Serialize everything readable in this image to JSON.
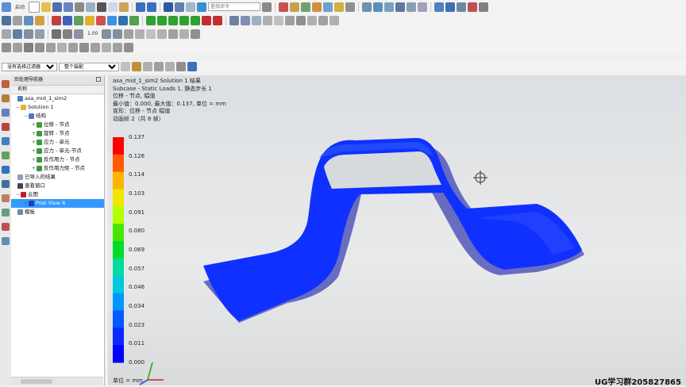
{
  "toolbar": {
    "start_label": "启动",
    "command_search_placeholder": "查找命令",
    "scale_value": "1.00",
    "filter_value": "没有选择过滤器",
    "assembly_value": "整个装配"
  },
  "navigator": {
    "title": "后处理导航器",
    "column_name": "名称",
    "items": [
      {
        "label": "asa_mid_1_sim2",
        "indent": 2,
        "exp": "",
        "icon_color": "#4a7fc0",
        "selected": false
      },
      {
        "label": "Solution 1",
        "indent": 6,
        "exp": "−",
        "icon_color": "#e2b43a",
        "selected": false
      },
      {
        "label": "结构",
        "indent": 16,
        "exp": "−",
        "icon_color": "#5a6fd0",
        "selected": false
      },
      {
        "label": "位移 - 节点",
        "indent": 26,
        "exp": "+",
        "icon_color": "#3c9a3c",
        "selected": false
      },
      {
        "label": "旋转 - 节点",
        "indent": 26,
        "exp": "+",
        "icon_color": "#3c9a3c",
        "selected": false
      },
      {
        "label": "应力 - 单元",
        "indent": 26,
        "exp": "+",
        "icon_color": "#3c9a3c",
        "selected": false
      },
      {
        "label": "应力 - 单元-节点",
        "indent": 26,
        "exp": "+",
        "icon_color": "#3c9a3c",
        "selected": false
      },
      {
        "label": "反作用力 - 节点",
        "indent": 26,
        "exp": "+",
        "icon_color": "#3c9a3c",
        "selected": false
      },
      {
        "label": "反作用力矩 - 节点",
        "indent": 26,
        "exp": "+",
        "icon_color": "#3c9a3c",
        "selected": false
      },
      {
        "label": "已导入的结果",
        "indent": 2,
        "exp": "",
        "icon_color": "#8aa0b8",
        "selected": false
      },
      {
        "label": "查看窗口",
        "indent": 2,
        "exp": "",
        "icon_color": "#444444",
        "selected": false
      },
      {
        "label": "云图",
        "indent": 6,
        "exp": "−",
        "icon_color": "#c02020",
        "selected": false
      },
      {
        "label": "Post View 6",
        "indent": 16,
        "exp": "+",
        "icon_color": "#2040c0",
        "selected": true
      },
      {
        "label": "模板",
        "indent": 2,
        "exp": "",
        "icon_color": "#6a8ab0",
        "selected": false
      }
    ]
  },
  "viewport": {
    "info_lines": [
      "asa_mid_1_sim2  Solution 1 结果",
      "Subcase - Static Loads 1, 静态步长 1",
      "位移 - 节点, 幅值",
      "最小值：0.000, 最大值：0.137, 单位 = mm",
      "变形：位移 - 节点 幅值",
      "动画帧 2（共 8 帧）"
    ],
    "legend_values": [
      "0.137",
      "0.126",
      "0.114",
      "0.103",
      "0.091",
      "0.080",
      "0.069",
      "0.057",
      "0.046",
      "0.034",
      "0.023",
      "0.011",
      "0.000"
    ],
    "legend_colors": [
      "#ff0000",
      "#ff5a00",
      "#ffb400",
      "#f0e600",
      "#b4ff00",
      "#46e600",
      "#00dc28",
      "#00dca0",
      "#00c8dc",
      "#0096ff",
      "#005aff",
      "#0a28ff",
      "#0000ff"
    ],
    "unit_label": "单位 = mm",
    "part_color": "#1030ff"
  },
  "watermark": "UG学习群205827865"
}
